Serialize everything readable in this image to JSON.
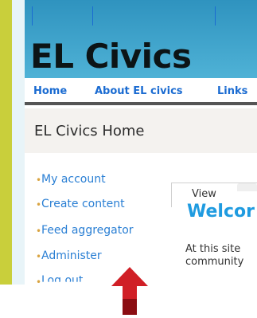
{
  "site": {
    "title": "EL Civics"
  },
  "nav": {
    "items": [
      "Home",
      "About EL civics",
      "Links"
    ]
  },
  "page": {
    "heading": "EL Civics Home"
  },
  "sidebar": {
    "items": [
      "My account",
      "Create content",
      "Feed aggregator",
      "Administer",
      "Log out"
    ]
  },
  "tabs": {
    "view_label": "View"
  },
  "main": {
    "welcome_prefix": "Welcor",
    "text_line1": "At this site",
    "text_line2": "community"
  },
  "colors": {
    "accent_arrow": "#d01f26",
    "link": "#2a7fd4",
    "header": "#3aa3cc"
  },
  "icons": {
    "bullet": "bullet-icon",
    "pointer": "up-arrow-icon"
  }
}
